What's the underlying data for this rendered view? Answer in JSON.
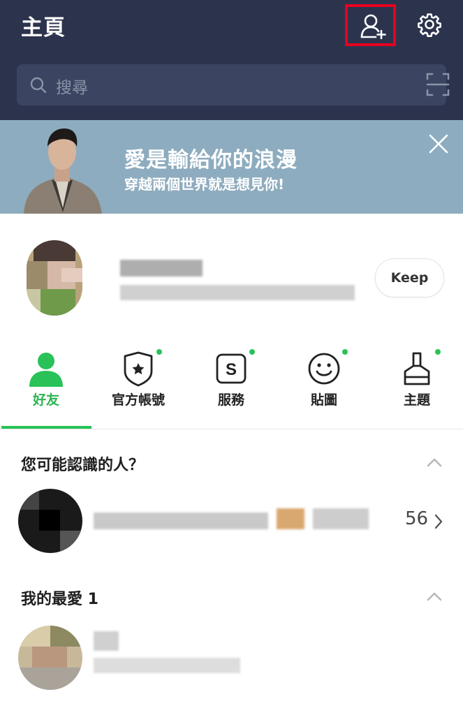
{
  "header": {
    "title": "主頁",
    "search_placeholder": "搜尋"
  },
  "banner": {
    "headline": "愛是輸給你的浪漫",
    "subtext": "穿越兩個世界就是想見你!"
  },
  "profile": {
    "keep_label": "Keep"
  },
  "tabs": [
    {
      "label": "好友",
      "icon": "person-icon",
      "active": true
    },
    {
      "label": "官方帳號",
      "icon": "shield-star-icon",
      "badge": true
    },
    {
      "label": "服務",
      "icon": "service-s-icon",
      "badge": true
    },
    {
      "label": "貼圖",
      "icon": "smiley-icon",
      "badge": true
    },
    {
      "label": "主題",
      "icon": "brush-icon",
      "badge": true
    }
  ],
  "suggestions": {
    "title": "您可能認識的人？",
    "count": "56"
  },
  "favorites": {
    "title": "我的最愛 1"
  },
  "colors": {
    "header_bg": "#2c344d",
    "banner_bg": "#8eacbf",
    "accent_green": "#29c258",
    "highlight_red": "#e8001f"
  }
}
